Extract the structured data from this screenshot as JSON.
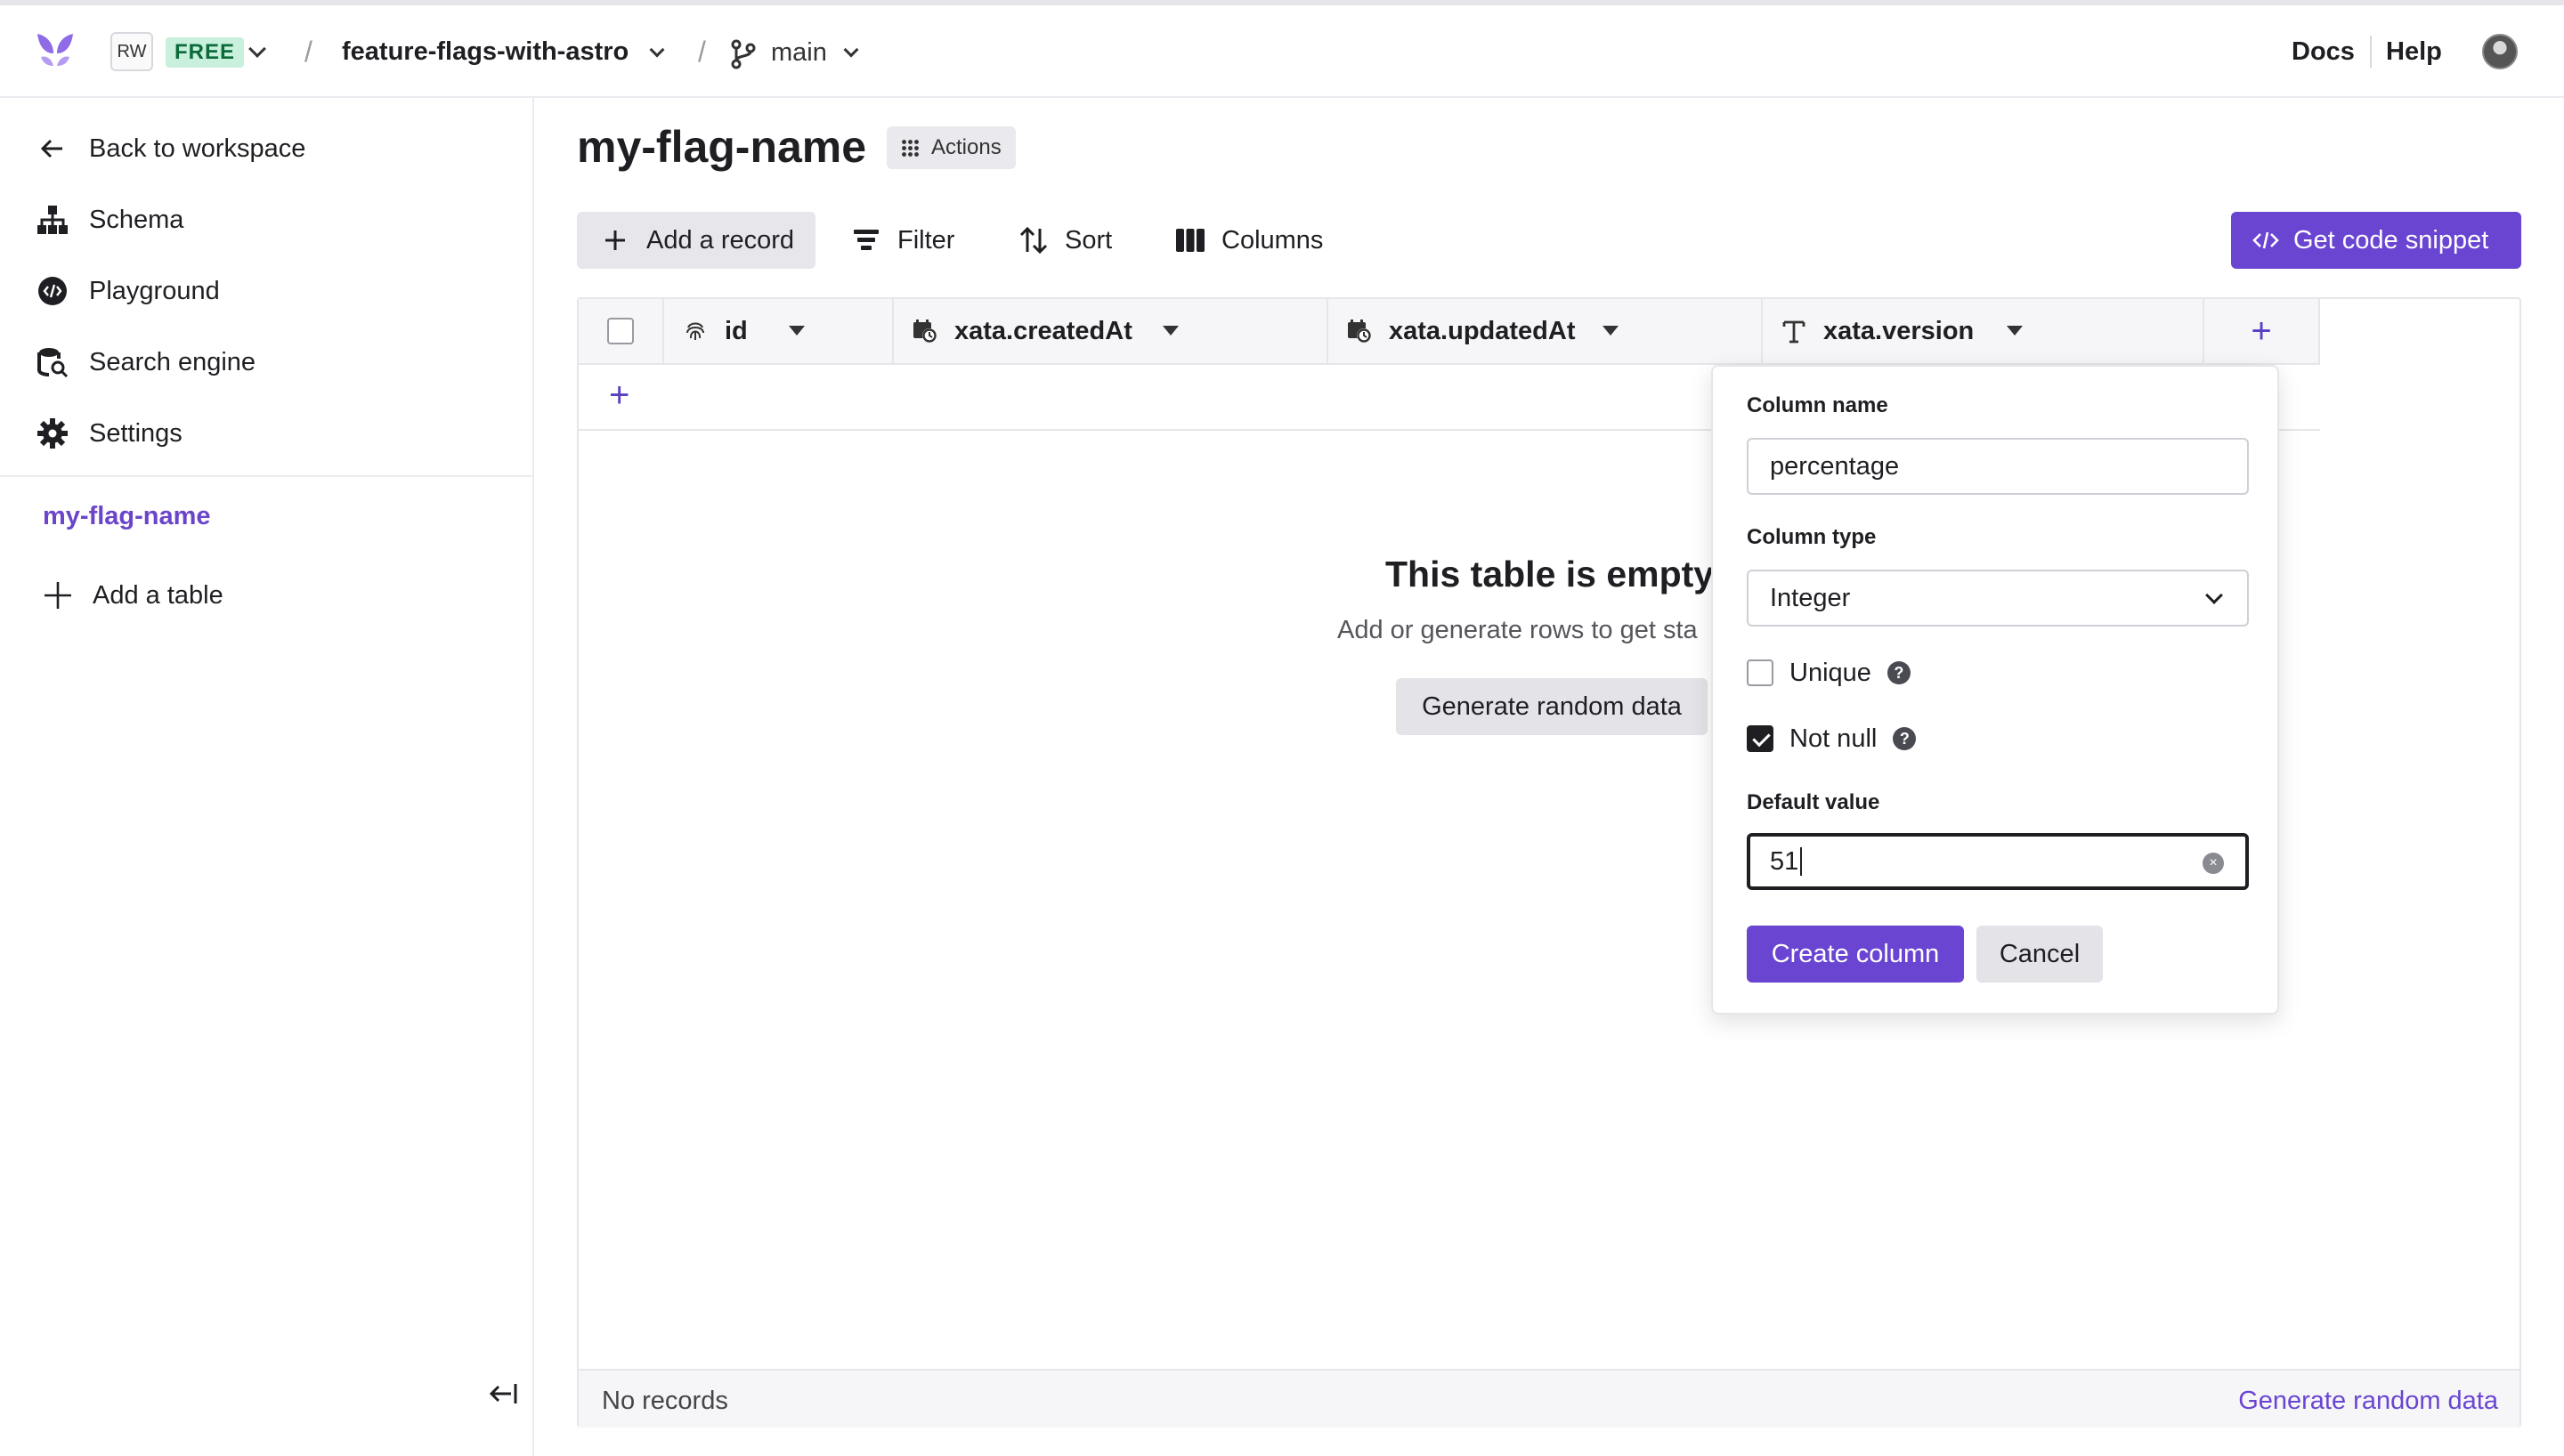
{
  "header": {
    "workspace_initials": "RW",
    "plan": "FREE",
    "separator": "/",
    "database": "feature-flags-with-astro",
    "branch": "main",
    "docs": "Docs",
    "help": "Help"
  },
  "sidebar": {
    "items": [
      {
        "label": "Back to workspace",
        "icon": "arrow-left-icon"
      },
      {
        "label": "Schema",
        "icon": "schema-icon"
      },
      {
        "label": "Playground",
        "icon": "playground-icon"
      },
      {
        "label": "Search engine",
        "icon": "search-engine-icon"
      },
      {
        "label": "Settings",
        "icon": "gear-icon"
      }
    ],
    "active_table": "my-flag-name",
    "add_table": "Add a table"
  },
  "main": {
    "title": "my-flag-name",
    "actions": "Actions",
    "toolbar": {
      "add_record": "Add a record",
      "filter": "Filter",
      "sort": "Sort",
      "columns": "Columns",
      "code_snippet": "Get code snippet"
    },
    "columns": [
      {
        "name": "id",
        "icon": "fingerprint-icon"
      },
      {
        "name": "xata.createdAt",
        "icon": "calendar-clock-icon"
      },
      {
        "name": "xata.updatedAt",
        "icon": "calendar-clock-icon"
      },
      {
        "name": "xata.version",
        "icon": "text-type-icon"
      }
    ],
    "empty": {
      "title": "This table is empty",
      "subtitle": "Add or generate rows to get sta",
      "generate": "Generate random data"
    },
    "footer": {
      "records": "No records",
      "generate_link": "Generate random data"
    }
  },
  "popover": {
    "column_name_label": "Column name",
    "column_name_value": "percentage",
    "column_type_label": "Column type",
    "column_type_value": "Integer",
    "unique_label": "Unique",
    "unique_checked": false,
    "not_null_label": "Not null",
    "not_null_checked": true,
    "help_glyph": "?",
    "default_value_label": "Default value",
    "default_value": "51",
    "create": "Create column",
    "cancel": "Cancel"
  },
  "colors": {
    "accent": "#6a45d1",
    "plan_badge_bg": "#c8f0dc",
    "plan_badge_text": "#0b6b3a"
  }
}
